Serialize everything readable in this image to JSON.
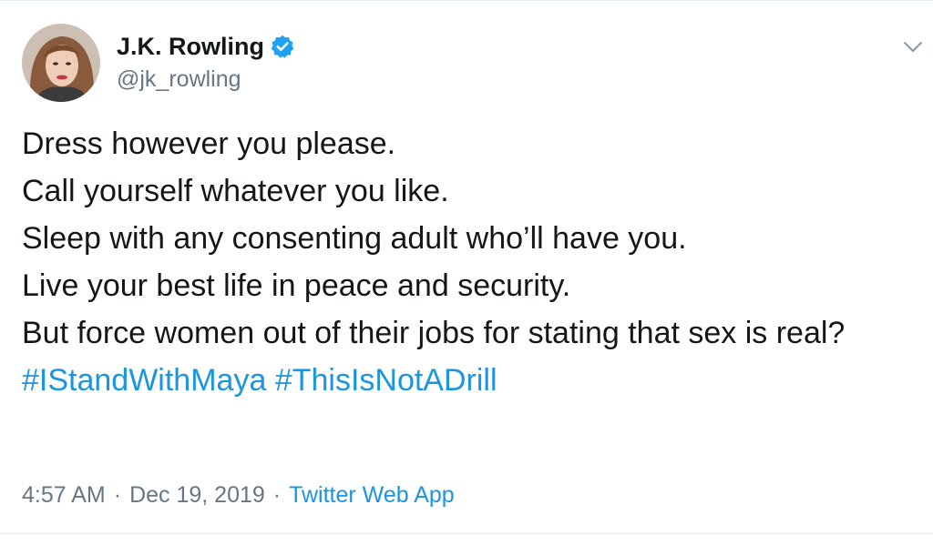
{
  "author": {
    "display_name": "J.K. Rowling",
    "handle": "@jk_rowling",
    "verified": true,
    "avatar_icon": "profile-photo"
  },
  "tweet": {
    "lines": [
      "Dress however you please.",
      "Call yourself whatever you like.",
      "Sleep with any consenting adult who’ll have you.",
      "Live your best life in peace and security.",
      "But force women out of their jobs for stating that sex is real?"
    ],
    "hashtags": [
      "#IStandWithMaya",
      "#ThisIsNotADrill"
    ]
  },
  "meta": {
    "time": "4:57 AM",
    "separator": "·",
    "date": "Dec 19, 2019",
    "source": "Twitter Web App"
  },
  "colors": {
    "text": "#14171a",
    "secondary": "#657786",
    "link": "#1b95e0",
    "verified_badge": "#1da1f2",
    "border": "#e6ecf0"
  },
  "icons": {
    "verified": "verified-badge-icon",
    "menu": "chevron-down-icon"
  }
}
